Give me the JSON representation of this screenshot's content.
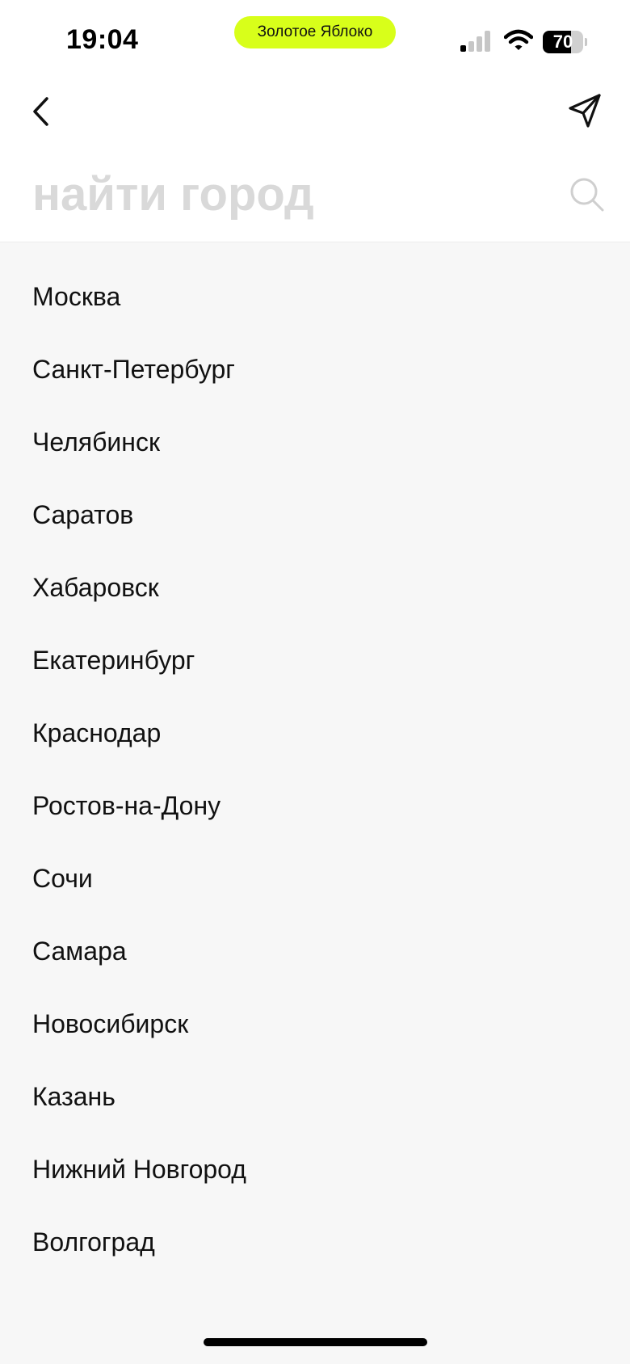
{
  "status_bar": {
    "time": "19:04",
    "app_label": "Золотое Яблоко",
    "battery_level": "70",
    "battery_fraction": 0.7,
    "signal_icon": "cellular-signal-icon",
    "wifi_icon": "wifi-icon"
  },
  "colors": {
    "accent": "#d8ff1a",
    "background": "#f7f7f7",
    "header_background": "#ffffff",
    "placeholder": "#d9d9d9"
  },
  "header": {
    "back_icon": "chevron-left-icon",
    "location_icon": "location-arrow-icon"
  },
  "search": {
    "placeholder": "найти город",
    "value": "",
    "icon": "search-icon"
  },
  "cities": [
    "Москва",
    "Санкт-Петербург",
    "Челябинск",
    "Саратов",
    "Хабаровск",
    "Екатеринбург",
    "Краснодар",
    "Ростов-на-Дону",
    "Сочи",
    "Самара",
    "Новосибирск",
    "Казань",
    "Нижний Новгород",
    "Волгоград"
  ]
}
